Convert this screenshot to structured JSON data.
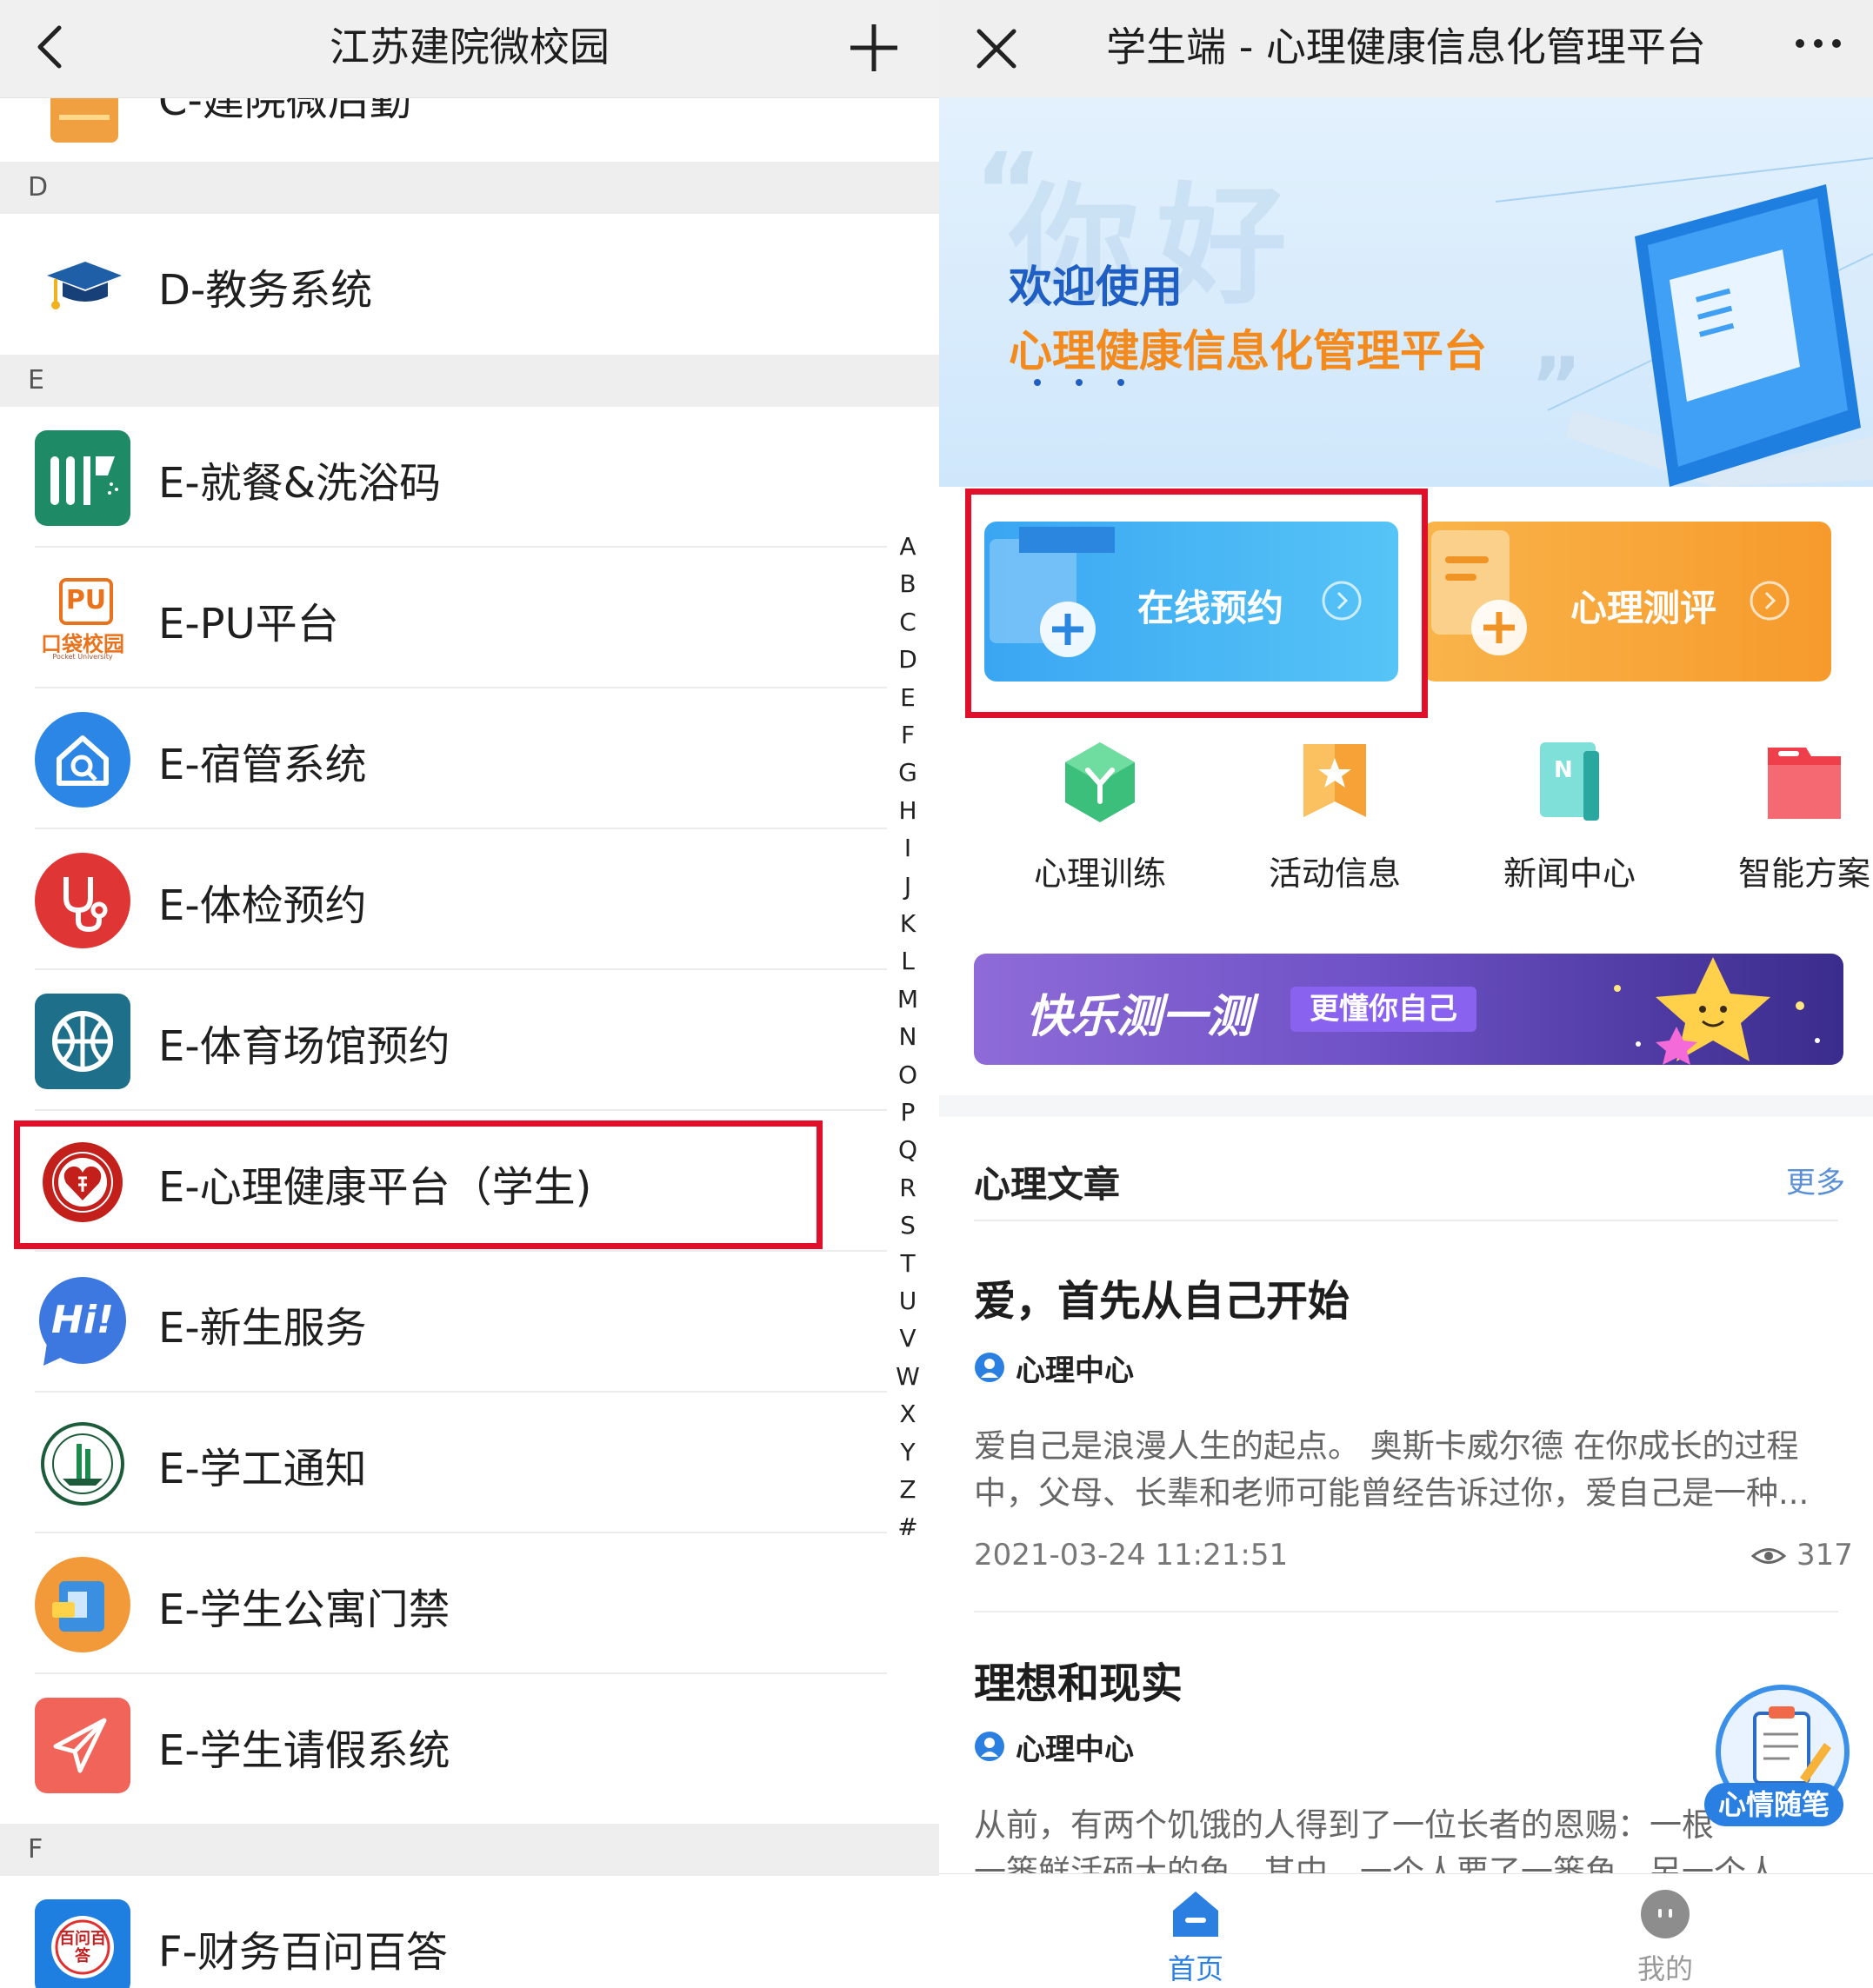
{
  "left": {
    "title": "江苏建院微校园",
    "partial_item": "C-建院微后勤",
    "sections": [
      {
        "letter": "D",
        "items": [
          {
            "label": "D-教务系统"
          }
        ]
      },
      {
        "letter": "E",
        "items": [
          {
            "label": "E-就餐&洗浴码"
          },
          {
            "label": "E-PU平台"
          },
          {
            "label": "E-宿管系统"
          },
          {
            "label": "E-体检预约"
          },
          {
            "label": "E-体育场馆预约"
          },
          {
            "label": "E-心理健康平台（学生)"
          },
          {
            "label": "E-新生服务"
          },
          {
            "label": "E-学工通知"
          },
          {
            "label": "E-学生公寓门禁"
          },
          {
            "label": "E-学生请假系统"
          }
        ]
      },
      {
        "letter": "F",
        "items": [
          {
            "label": "F-财务百问百答"
          }
        ]
      }
    ],
    "pu_logo": {
      "top": "PU",
      "bottom": "口袋校园",
      "tiny": "Pocket University"
    },
    "hi_logo": "Hi!",
    "baiwen_logo": "百问百答",
    "alphabet_index": [
      "A",
      "B",
      "C",
      "D",
      "E",
      "F",
      "G",
      "H",
      "I",
      "J",
      "K",
      "L",
      "M",
      "N",
      "O",
      "P",
      "Q",
      "R",
      "S",
      "T",
      "U",
      "V",
      "W",
      "X",
      "Y",
      "Z",
      "#"
    ],
    "highlight_color": "#e0102a"
  },
  "right": {
    "title": "学生端 - 心理健康信息化管理平台",
    "banner": {
      "bg_word": "你好",
      "line1": "欢迎使用",
      "line2": "心理健康信息化管理平台"
    },
    "tiles": [
      {
        "label": "在线预约",
        "color": "#35aaf0"
      },
      {
        "label": "心理测评",
        "color": "#f7a532"
      }
    ],
    "grid": [
      {
        "label": "心理训练",
        "icon": "training-icon"
      },
      {
        "label": "活动信息",
        "icon": "activity-icon"
      },
      {
        "label": "新闻中心",
        "icon": "news-icon"
      },
      {
        "label": "智能方案",
        "icon": "solution-icon"
      }
    ],
    "happy_banner": {
      "main": "快乐测一测",
      "sub": "更懂你自己"
    },
    "articles_section": {
      "title": "心理文章",
      "more": "更多"
    },
    "articles": [
      {
        "title": "爱，首先从自己开始",
        "author": "心理中心",
        "excerpt1": "爱自己是浪漫人生的起点。 奥斯卡威尔德 在你成长的过程",
        "excerpt2": "中，父母、长辈和老师可能曾经告诉过你，爱自己是一种...",
        "date": "2021-03-24 11:21:51",
        "views": "317"
      },
      {
        "title": "理想和现实",
        "author": "心理中心",
        "excerpt1": "从前，有两个饥饿的人得到了一位长者的恩赐：一根",
        "excerpt2": "一篓鲜活硕大的鱼。其中，一个人要了一篓鱼，另一个人"
      }
    ],
    "float_button": "心情随笔",
    "nav": [
      {
        "label": "首页",
        "active": true
      },
      {
        "label": "我的",
        "active": false
      }
    ],
    "accent": "#2b7fe0"
  }
}
